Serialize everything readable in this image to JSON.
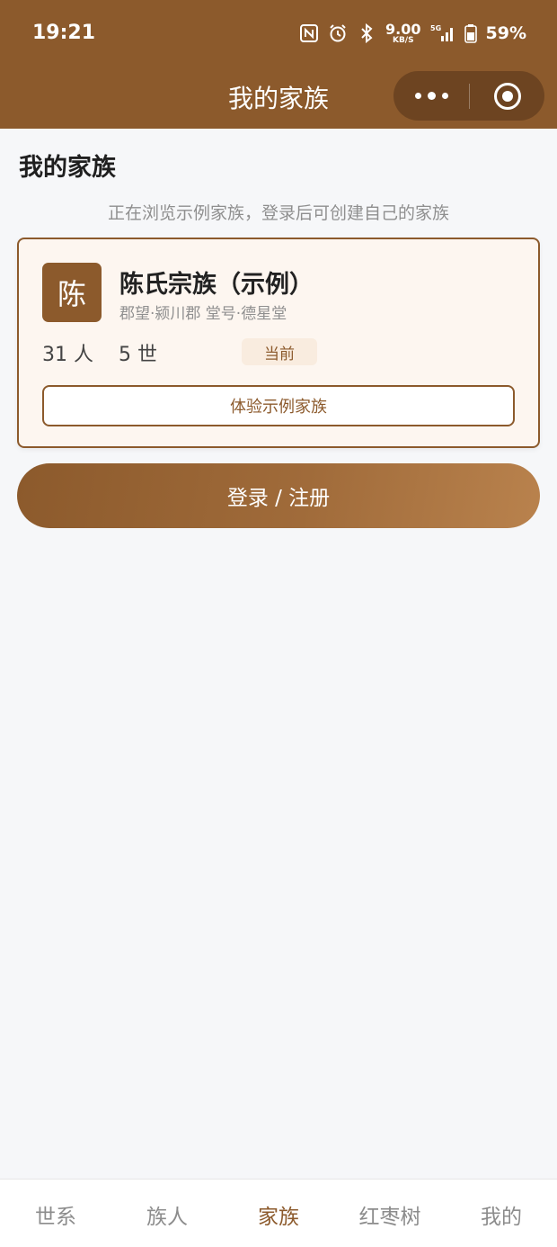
{
  "status_bar": {
    "time": "19:21",
    "net_speed": "9.00",
    "net_unit": "KB/S",
    "network": "5G",
    "battery": "59%"
  },
  "nav": {
    "title": "我的家族"
  },
  "page": {
    "heading": "我的家族",
    "notice": "正在浏览示例家族，登录后可创建自己的家族"
  },
  "clan_card": {
    "avatar_char": "陈",
    "name": "陈氏宗族（示例）",
    "meta": "郡望·颍川郡 堂号·德星堂",
    "people": "31 人",
    "generations": "5 世",
    "current_tag": "当前",
    "try_button": "体验示例家族"
  },
  "login_button": "登录 / 注册",
  "tabs": [
    {
      "label": "世系"
    },
    {
      "label": "族人"
    },
    {
      "label": "家族"
    },
    {
      "label": "红枣树"
    },
    {
      "label": "我的"
    }
  ],
  "colors": {
    "brand": "#8c5a2c",
    "tag_bg": "#f9ecdf",
    "card_bg": "#fdf6f0"
  }
}
